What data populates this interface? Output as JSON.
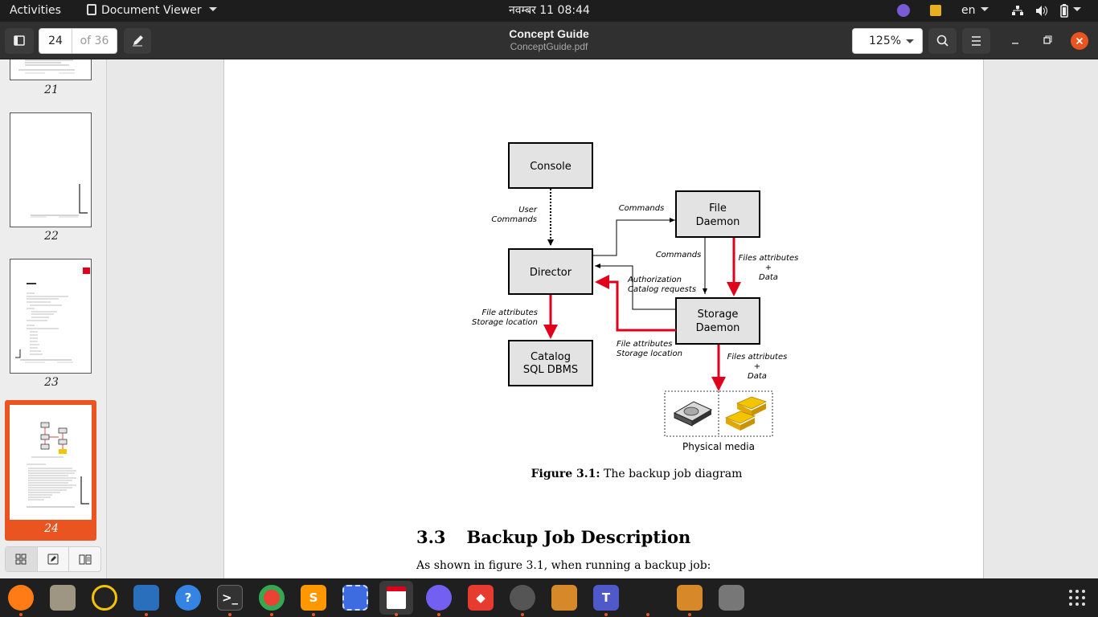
{
  "topbar": {
    "activities": "Activities",
    "app_menu": "Document Viewer",
    "clock": "नवम्बर 11  08:44",
    "lang": "en"
  },
  "header": {
    "page_current": "24",
    "page_total": "of 36",
    "title": "Concept Guide",
    "filename": "ConceptGuide.pdf",
    "zoom": "125%"
  },
  "sidebar": {
    "thumbnails": [
      {
        "page": "21"
      },
      {
        "page": "22"
      },
      {
        "page": "23",
        "heading": "The Job"
      },
      {
        "page": "24",
        "selected": true
      }
    ]
  },
  "diagram": {
    "nodes": {
      "console": "Console",
      "director": "Director",
      "catalog_l1": "Catalog",
      "catalog_l2": "SQL DBMS",
      "fd_l1": "File",
      "fd_l2": "Daemon",
      "sd_l1": "Storage",
      "sd_l2": "Daemon",
      "media": "Physical media"
    },
    "labels": {
      "user_commands_1": "User",
      "user_commands_2": "Commands",
      "commands_top": "Commands",
      "commands_mid": "Commands",
      "fattr_data_1": "Files attributes",
      "fattr_data_2": "+",
      "fattr_data_3": "Data",
      "auth_1": "Authorization",
      "auth_2": "Catalog requests",
      "cat_fa_1": "File attributes",
      "cat_fa_2": "Storage location",
      "sd_fa_1": "File attributes",
      "sd_fa_2": "Storage location",
      "media_fa_1": "Files attributes",
      "media_fa_2": "+",
      "media_fa_3": "Data"
    },
    "caption_label": "Figure 3.1:",
    "caption_text": "The backup job diagram"
  },
  "section": {
    "number": "3.3",
    "title": "Backup Job Description",
    "body": "As shown in figure 3.1, when running a backup job:"
  },
  "colors": {
    "accent": "#e95420",
    "arrow_red": "#e0001b",
    "node_fill": "#e3e3e3"
  }
}
